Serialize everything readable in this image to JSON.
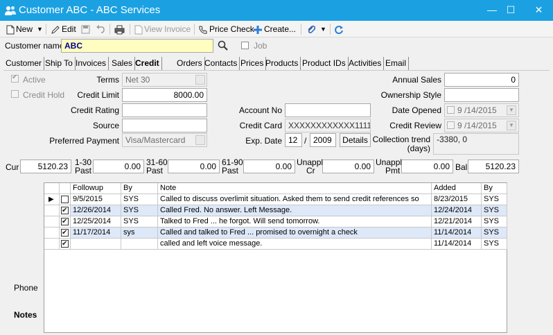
{
  "window": {
    "title": "Customer ABC - ABC Services",
    "min": "—",
    "max": "☐",
    "close": "✕"
  },
  "toolbar": {
    "new": "New",
    "edit": "Edit",
    "view_invoice": "View Invoice",
    "price_check": "Price Check",
    "create": "Create..."
  },
  "customer": {
    "name_label": "Customer name",
    "name_value": "ABC",
    "job_label": "Job"
  },
  "tabs": [
    "Customer",
    "Ship To",
    "Invoices",
    "Sales",
    "Credit",
    "Orders",
    "Contacts",
    "Prices",
    "Products",
    "Product IDs",
    "Activities",
    "Email"
  ],
  "active_tab": "Credit",
  "credit": {
    "active_label": "Active",
    "credit_hold_label": "Credit Hold",
    "terms_label": "Terms",
    "terms_value": "Net 30",
    "credit_limit_label": "Credit Limit",
    "credit_limit_value": "8000.00",
    "credit_rating_label": "Credit Rating",
    "credit_rating_value": "",
    "source_label": "Source",
    "source_value": "",
    "preferred_payment_label": "Preferred Payment",
    "preferred_payment_value": "Visa/Mastercard",
    "account_no_label": "Account No",
    "account_no_value": "",
    "credit_card_label": "Credit Card",
    "credit_card_value": "XXXXXXXXXXXX1111",
    "exp_date_label": "Exp. Date",
    "exp_month": "12",
    "exp_sep": "/",
    "exp_year": "2009",
    "details_button": "Details",
    "annual_sales_label": "Annual Sales",
    "annual_sales_value": "0",
    "ownership_style_label": "Ownership Style",
    "ownership_style_value": "",
    "date_opened_label": "Date Opened",
    "date_opened_value": "9 /14/2015",
    "credit_review_label": "Credit Review",
    "credit_review_value": "9 /14/2015",
    "collection_trend_label_1": "Collection trend",
    "collection_trend_label_2": "(days)",
    "collection_trend_value": "-3380, 0"
  },
  "aging": {
    "cur_label": "Cur",
    "cur_value": "5120.23",
    "p1_30_label_1": "1-30",
    "p1_30_label_2": "Past",
    "p1_30_value": "0.00",
    "p31_60_label_1": "31-60",
    "p31_60_label_2": "Past",
    "p31_60_value": "0.00",
    "p61_90_label_1": "61-90",
    "p61_90_label_2": "Past",
    "p61_90_value": "0.00",
    "unappl_cr_label_1": "Unappl",
    "unappl_cr_label_2": "Cr",
    "unappl_cr_value": "0.00",
    "unappl_pmt_label_1": "Unappl",
    "unappl_pmt_label_2": "Pmt",
    "unappl_pmt_value": "0.00",
    "bal_label": "Bal",
    "bal_value": "5120.23"
  },
  "notes_grid": {
    "headers": {
      "followup": "Followup",
      "by": "By",
      "note": "Note",
      "added": "Added",
      "by2": "By"
    },
    "rows": [
      {
        "checked": false,
        "followup": "9/5/2015",
        "by": "SYS",
        "note": "Called to discuss overlimit situation.  Asked them to send credit references so",
        "added": "8/23/2015",
        "by2": "SYS",
        "current": true
      },
      {
        "checked": true,
        "followup": "12/26/2014",
        "by": "SYS",
        "note": "Called Fred.  No answer.  Left Message.",
        "added": "12/24/2014",
        "by2": "SYS"
      },
      {
        "checked": true,
        "followup": "12/25/2014",
        "by": "SYS",
        "note": "Talked to Fred ... he forgot.  Will send tomorrow.",
        "added": "12/21/2014",
        "by2": "SYS"
      },
      {
        "checked": true,
        "followup": "11/17/2014",
        "by": "sys",
        "note": "Called and talked to Fred ... promised to overnight a check",
        "added": "11/14/2014",
        "by2": "SYS"
      },
      {
        "checked": true,
        "followup": "",
        "by": "",
        "note": "called and left voice message.",
        "added": "11/14/2014",
        "by2": "SYS"
      }
    ]
  },
  "side_tabs": {
    "phone": "Phone",
    "notes": "Notes"
  }
}
